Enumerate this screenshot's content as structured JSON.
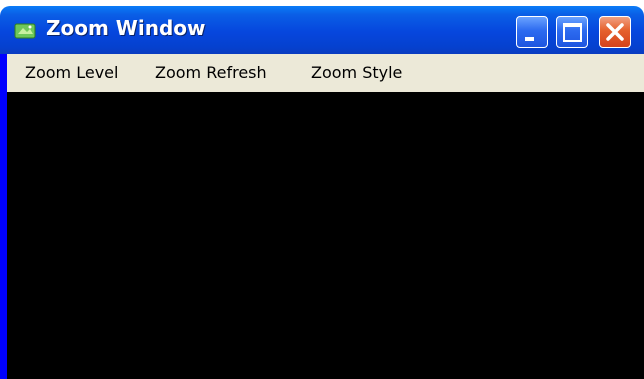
{
  "window": {
    "title": "Zoom Window",
    "app_icon": "green-card-icon",
    "controls": {
      "minimize_icon": "minimize-icon",
      "maximize_icon": "maximize-icon",
      "close_icon": "close-icon"
    }
  },
  "menubar": {
    "items": [
      {
        "label": "Zoom Level"
      },
      {
        "label": "Zoom Refresh"
      },
      {
        "label": "Zoom Style"
      }
    ]
  },
  "client_area": {
    "background_color": "#000000"
  },
  "colors": {
    "titlebar_blue": "#0646dd",
    "menubar_bg": "#ece9d8",
    "close_button": "#e5602c",
    "frame_blue": "#0000ff"
  }
}
